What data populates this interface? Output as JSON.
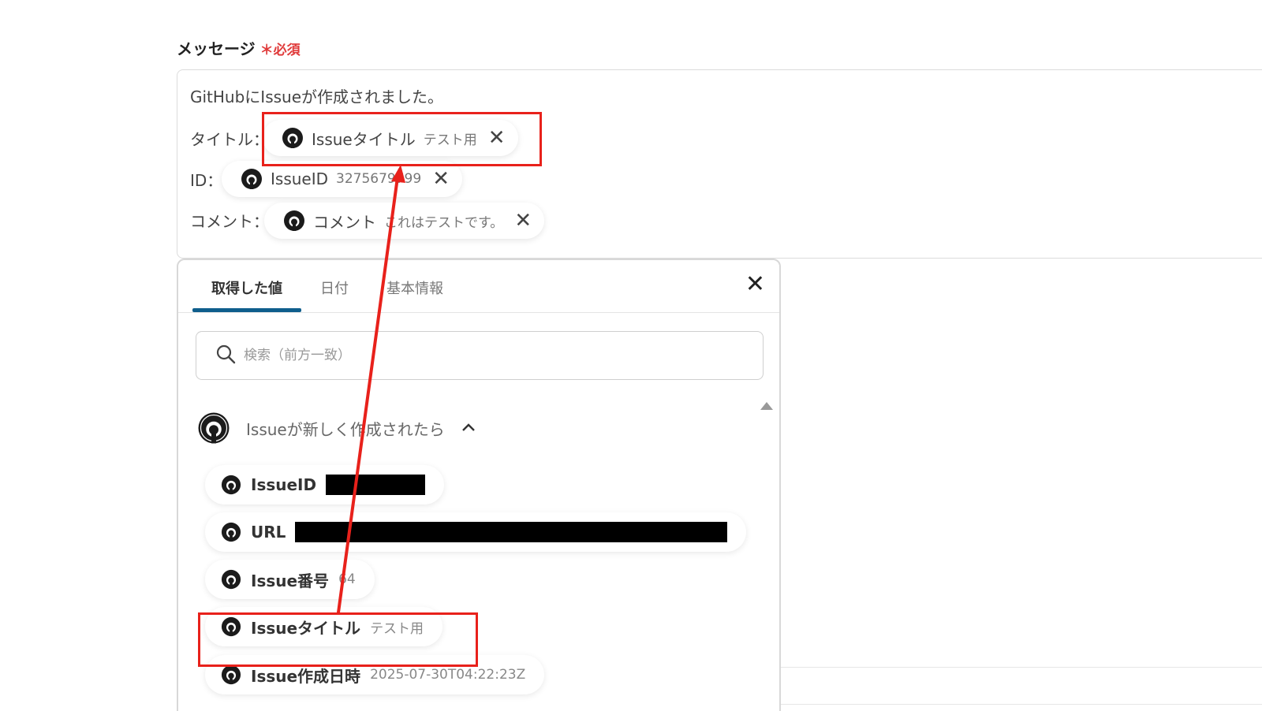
{
  "field": {
    "label": "メッセージ",
    "required": "＊必須"
  },
  "message": {
    "line1": "GitHubにIssueが作成されました。",
    "rows": [
      {
        "label": "タイトル：",
        "chip_name": "Issueタイトル",
        "chip_value": "テスト用"
      },
      {
        "label": "ID：",
        "chip_name": "IssueID",
        "chip_value": "3275679799"
      },
      {
        "label": "コメント：",
        "chip_name": "コメント",
        "chip_value": "これはテストです。"
      }
    ],
    "remove_glyph": "✕"
  },
  "popup": {
    "tabs": [
      "取得した値",
      "日付",
      "基本情報"
    ],
    "active_tab": 0,
    "close_glyph": "✕",
    "search_placeholder": "検索（前方一致）",
    "group": {
      "title": "Issueが新しく作成されたら",
      "expanded": true,
      "items": [
        {
          "name": "IssueID",
          "value": "",
          "redacted": true
        },
        {
          "name": "URL",
          "value": "",
          "redacted": true
        },
        {
          "name": "Issue番号",
          "value": "64",
          "redacted": false
        },
        {
          "name": "Issueタイトル",
          "value": "テスト用",
          "redacted": false
        },
        {
          "name": "Issue作成日時",
          "value": "2025-07-30T04:22:23Z",
          "redacted": false
        }
      ]
    }
  },
  "colors": {
    "highlight": "#e8211b",
    "tab_underline": "#0f5e8c",
    "required": "#e03a3a"
  },
  "icons": {
    "chip_icon": "github-icon",
    "search_icon": "search-icon",
    "close_icon": "close-icon",
    "chevron_icon": "chevron-up-icon"
  }
}
